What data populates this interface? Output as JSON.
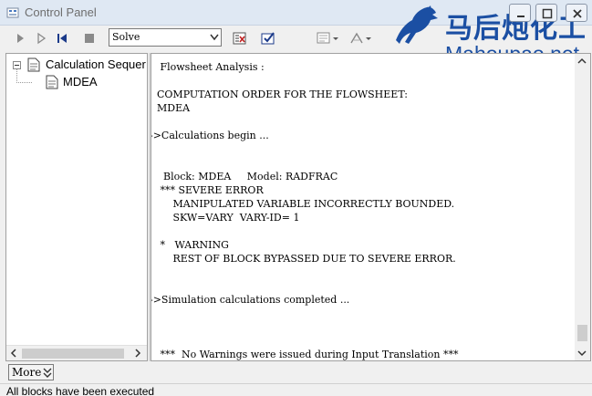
{
  "window": {
    "title": "Control Panel"
  },
  "watermark": {
    "chinese": "马后炮化工",
    "site": "Mahoupao.net"
  },
  "toolbar": {
    "run_mode": "Solve"
  },
  "tree": {
    "root": "Calculation Sequer",
    "child": "MDEA"
  },
  "log": {
    "lines": [
      " Flowsheet Analysis :",
      "",
      "COMPUTATION ORDER FOR THE FLOWSHEET:",
      "MDEA",
      "",
      "->Calculations begin ...",
      "",
      "",
      "  Block: MDEA     Model: RADFRAC",
      " *** SEVERE ERROR",
      "     MANIPULATED VARIABLE INCORRECTLY BOUNDED.",
      "     SKW=VARY  VARY-ID= 1",
      "",
      " *   WARNING",
      "     REST OF BLOCK BYPASSED DUE TO SEVERE ERROR.",
      "",
      "",
      "->Simulation calculations completed ...",
      "",
      "",
      "",
      " ***  No Warnings were issued during Input Translation ***"
    ]
  },
  "more_button": {
    "label": "More"
  },
  "status": {
    "text": "All blocks have been executed"
  }
}
